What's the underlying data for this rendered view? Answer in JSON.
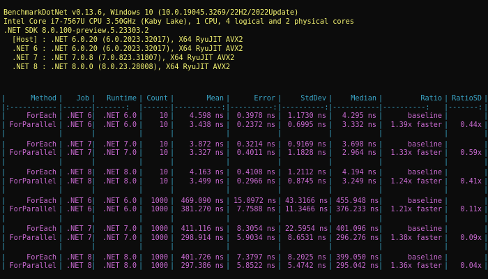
{
  "header": {
    "line1": "BenchmarkDotNet v0.13.6, Windows 10 (10.0.19045.3269/22H2/2022Update)",
    "line2": "Intel Core i7-7567U CPU 3.50GHz (Kaby Lake), 1 CPU, 4 logical and 2 physical cores",
    "line3": ".NET SDK 8.0.100-preview.5.23303.2",
    "line4": "  [Host] : .NET 6.0.20 (6.0.2023.32017), X64 RyuJIT AVX2",
    "line5": "  .NET 6 : .NET 6.0.20 (6.0.2023.32017), X64 RyuJIT AVX2",
    "line6": "  .NET 7 : .NET 7.0.8 (7.0.823.31807), X64 RyuJIT AVX2",
    "line7": "  .NET 8 : .NET 8.0.0 (8.0.23.28008), X64 RyuJIT AVX2"
  },
  "table": {
    "columns": [
      "Method",
      "Job",
      "Runtime",
      "Count",
      "Mean",
      "Error",
      "StdDev",
      "Median",
      "Ratio",
      "RatioSD"
    ],
    "separator": [
      ":-----------",
      "-------:",
      "-------:",
      "-------:",
      "-----------:",
      "----------:",
      "----------:",
      "-----------:",
      "----------:",
      "-------:"
    ],
    "rows": [
      [
        "ForEach",
        ".NET 6",
        ".NET 6.0",
        "10",
        "4.598 ns",
        "0.3978 ns",
        "1.1730 ns",
        "4.295 ns",
        "baseline",
        ""
      ],
      [
        "ForParallel",
        ".NET 6",
        ".NET 6.0",
        "10",
        "3.438 ns",
        "0.2372 ns",
        "0.6995 ns",
        "3.332 ns",
        "1.39x faster",
        "0.44x"
      ],
      [
        "ForEach",
        ".NET 7",
        ".NET 7.0",
        "10",
        "3.872 ns",
        "0.3214 ns",
        "0.9169 ns",
        "3.698 ns",
        "baseline",
        ""
      ],
      [
        "ForParallel",
        ".NET 7",
        ".NET 7.0",
        "10",
        "3.327 ns",
        "0.4011 ns",
        "1.1828 ns",
        "2.964 ns",
        "1.33x faster",
        "0.59x"
      ],
      [
        "ForEach",
        ".NET 8",
        ".NET 8.0",
        "10",
        "4.163 ns",
        "0.4108 ns",
        "1.2112 ns",
        "4.194 ns",
        "baseline",
        ""
      ],
      [
        "ForParallel",
        ".NET 8",
        ".NET 8.0",
        "10",
        "3.499 ns",
        "0.2966 ns",
        "0.8745 ns",
        "3.249 ns",
        "1.24x faster",
        "0.41x"
      ],
      [
        "ForEach",
        ".NET 6",
        ".NET 6.0",
        "1000",
        "469.090 ns",
        "15.0972 ns",
        "43.3166 ns",
        "455.948 ns",
        "baseline",
        ""
      ],
      [
        "ForParallel",
        ".NET 6",
        ".NET 6.0",
        "1000",
        "381.270 ns",
        "7.7588 ns",
        "11.3466 ns",
        "376.233 ns",
        "1.21x faster",
        "0.11x"
      ],
      [
        "ForEach",
        ".NET 7",
        ".NET 7.0",
        "1000",
        "411.116 ns",
        "8.3054 ns",
        "22.5954 ns",
        "401.096 ns",
        "baseline",
        ""
      ],
      [
        "ForParallel",
        ".NET 7",
        ".NET 7.0",
        "1000",
        "298.914 ns",
        "5.9034 ns",
        "8.6531 ns",
        "296.276 ns",
        "1.38x faster",
        "0.09x"
      ],
      [
        "ForEach",
        ".NET 8",
        ".NET 8.0",
        "1000",
        "401.726 ns",
        "7.3797 ns",
        "8.2025 ns",
        "399.050 ns",
        "baseline",
        ""
      ],
      [
        "ForParallel",
        ".NET 8",
        ".NET 8.0",
        "1000",
        "297.386 ns",
        "5.8522 ns",
        "5.4742 ns",
        "295.042 ns",
        "1.36x faster",
        "0.04x"
      ]
    ]
  },
  "colors": {
    "background": "#0c0c0c",
    "header_text": "#f0f070",
    "table_border": "#3aa6c8",
    "table_values": "#c86ad0"
  }
}
